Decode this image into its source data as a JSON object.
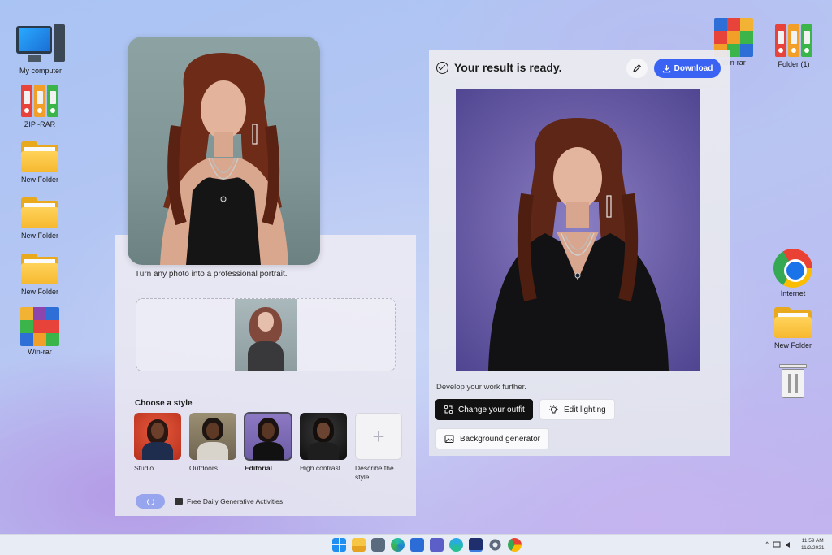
{
  "desktop": {
    "left_icons": [
      {
        "label": "My computer",
        "icon": "computer-icon"
      },
      {
        "label": "ZIP -RAR",
        "icon": "binders-icon"
      },
      {
        "label": "New Folder",
        "icon": "folder-icon"
      },
      {
        "label": "New Folder",
        "icon": "folder-icon"
      },
      {
        "label": "New Folder",
        "icon": "folder-icon"
      },
      {
        "label": "Win-rar",
        "icon": "winrar-icon"
      }
    ],
    "right_icons": [
      {
        "label": "Win-rar",
        "icon": "winrar-icon"
      },
      {
        "label": "Folder (1)",
        "icon": "binders-icon"
      },
      {
        "label": "Internet",
        "icon": "chrome-icon"
      },
      {
        "label": "New Folder",
        "icon": "folder-icon"
      },
      {
        "label": "",
        "icon": "recycle-bin-icon"
      }
    ]
  },
  "left_panel": {
    "tagline": "Turn any photo into a professional portrait.",
    "choose_style_label": "Choose a style",
    "styles": [
      {
        "label": "Studio",
        "selected": false
      },
      {
        "label": "Outdoors",
        "selected": false
      },
      {
        "label": "Editorial",
        "selected": true
      },
      {
        "label": "High contrast",
        "selected": false
      },
      {
        "label": "Describe the style",
        "selected": false
      }
    ],
    "credits_label": "Free Daily Generative Activities"
  },
  "right_panel": {
    "title": "Your result is ready.",
    "download_label": "Download",
    "develop_label": "Develop your work further.",
    "actions": [
      {
        "label": "Change your outfit",
        "icon": "outfit-icon"
      },
      {
        "label": "Edit lighting",
        "icon": "lightbulb-icon"
      },
      {
        "label": "Background generator",
        "icon": "image-gen-icon"
      }
    ]
  },
  "taskbar": {
    "apps": [
      "windows-start-icon",
      "file-explorer-icon",
      "camera-icon",
      "edge-icon",
      "store-icon",
      "teams-icon",
      "photos-icon",
      "app-icon",
      "settings-icon",
      "chrome-icon"
    ],
    "time": "11:59 AM",
    "date": "11/2/2021",
    "tray_chevron": "^"
  },
  "colors": {
    "accent": "#3b63f3",
    "dark_chip": "#111111",
    "spinner": "#97a5ee"
  }
}
